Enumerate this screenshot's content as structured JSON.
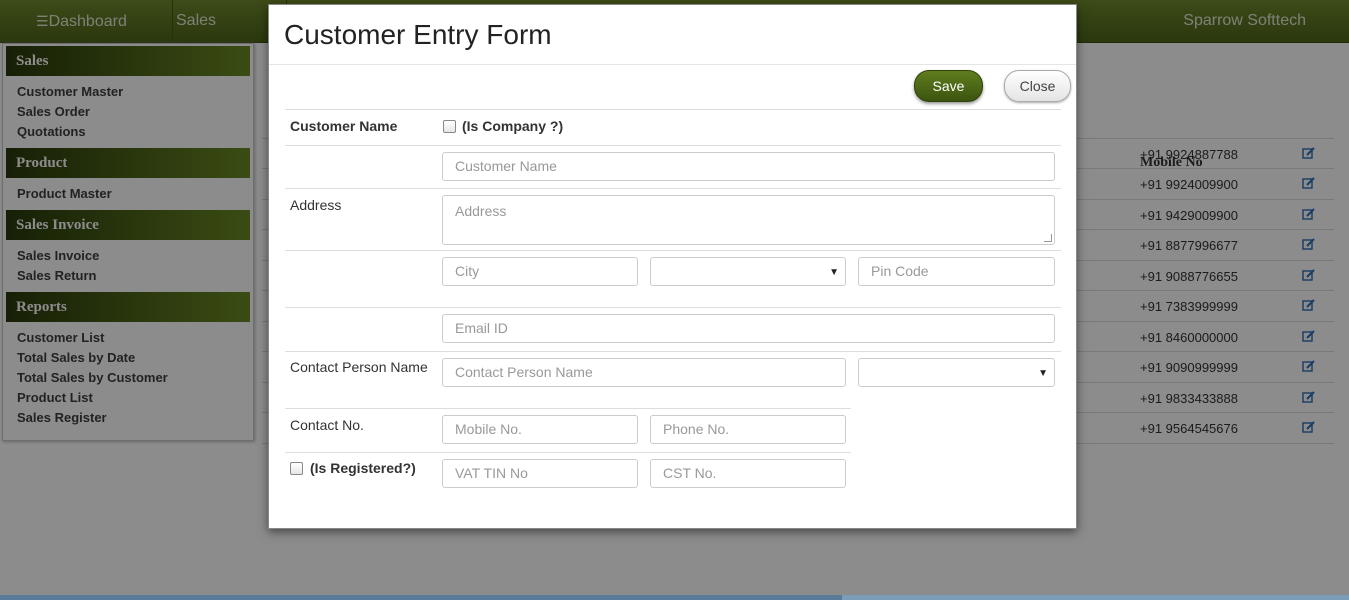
{
  "navbar": {
    "dashboard_label": "Dashboard",
    "sales_label": "Sales",
    "brand": "Sparrow Softtech"
  },
  "sidebar": {
    "groups": [
      {
        "title": "Sales",
        "items": [
          "Customer Master",
          "Sales Order",
          "Quotations"
        ]
      },
      {
        "title": "Product",
        "items": [
          "Product Master"
        ]
      },
      {
        "title": "Sales Invoice",
        "items": [
          "Sales Invoice",
          "Sales Return"
        ]
      },
      {
        "title": "Reports",
        "items": [
          "Customer List",
          "Total Sales by Date",
          "Total Sales by Customer",
          "Product List",
          "Sales Register"
        ]
      }
    ]
  },
  "background_table": {
    "mobile_header": "Mobile No",
    "mobiles": [
      "+91 9924887788",
      "+91 9924009900",
      "+91 9429009900",
      "+91 8877996677",
      "+91 9088776655",
      "+91 7383999999",
      "+91 8460000000",
      "+91 9090999999",
      "+91 9833433888",
      "+91 9564545676"
    ]
  },
  "modal": {
    "title": "Customer Entry Form",
    "save_label": "Save",
    "close_label": "Close",
    "customer_name_label": "Customer Name",
    "is_company_label": "(Is Company ?)",
    "customer_name_placeholder": "Customer Name",
    "address_label": "Address",
    "address_placeholder": "Address",
    "city_placeholder": "City",
    "pin_placeholder": "Pin Code",
    "email_placeholder": "Email ID",
    "contact_person_label": "Contact Person Name",
    "contact_person_placeholder": "Contact Person Name",
    "contact_no_label": "Contact No.",
    "mobile_placeholder": "Mobile No.",
    "phone_placeholder": "Phone No.",
    "is_registered_label": "(Is Registered?)",
    "vat_placeholder": "VAT TIN No",
    "cst_placeholder": "CST No."
  },
  "colors": {
    "nav_green": "#5a7321",
    "save_green": "#4e6a17"
  }
}
